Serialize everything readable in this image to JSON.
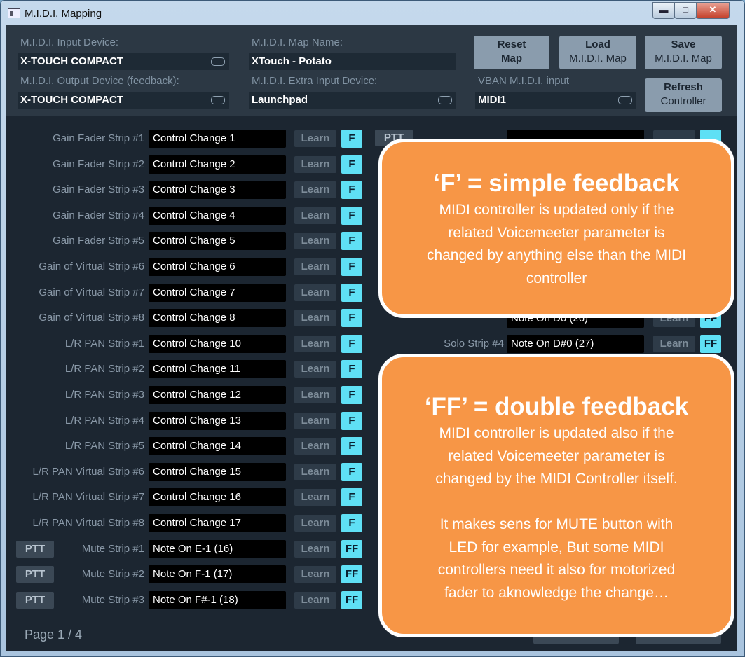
{
  "window": {
    "title": "M.I.D.I. Mapping",
    "min_glyph": "▬",
    "max_glyph": "□",
    "close_glyph": "✕"
  },
  "header": {
    "input_device_label": "M.I.D.I. Input Device:",
    "input_device_value": "X-TOUCH COMPACT",
    "map_name_label": "M.I.D.I. Map Name:",
    "map_name_value": "XTouch - Potato",
    "output_device_label": "M.I.D.I. Output Device (feedback):",
    "output_device_value": "X-TOUCH COMPACT",
    "extra_input_label": "M.I.D.I. Extra Input Device:",
    "extra_input_value": "Launchpad",
    "vban_label": "VBAN M.I.D.I. input",
    "vban_value": "MIDI1",
    "reset_line1": "Reset",
    "reset_line2": "Map",
    "load_line1": "Load",
    "load_line2": "M.I.D.I. Map",
    "save_line1": "Save",
    "save_line2": "M.I.D.I. Map",
    "refresh_line1": "Refresh",
    "refresh_line2": "Controller"
  },
  "learn_label": "Learn",
  "ptt_label": "PTT",
  "rows": [
    {
      "label": "Gain Fader Strip #1",
      "value": "Control Change 1",
      "fb": "F",
      "ptt": false
    },
    {
      "label": "Gain Fader Strip #2",
      "value": "Control Change 2",
      "fb": "F",
      "ptt": false
    },
    {
      "label": "Gain Fader Strip #3",
      "value": "Control Change 3",
      "fb": "F",
      "ptt": false
    },
    {
      "label": "Gain Fader Strip #4",
      "value": "Control Change 4",
      "fb": "F",
      "ptt": false
    },
    {
      "label": "Gain Fader Strip #5",
      "value": "Control Change 5",
      "fb": "F",
      "ptt": false
    },
    {
      "label": "Gain of Virtual Strip #6",
      "value": "Control Change 6",
      "fb": "F",
      "ptt": false
    },
    {
      "label": "Gain of Virtual Strip #7",
      "value": "Control Change 7",
      "fb": "F",
      "ptt": false
    },
    {
      "label": "Gain of Virtual Strip #8",
      "value": "Control Change 8",
      "fb": "F",
      "ptt": false
    },
    {
      "label": "L/R PAN Strip #1",
      "value": "Control Change 10",
      "fb": "F",
      "ptt": false
    },
    {
      "label": "L/R PAN Strip #2",
      "value": "Control Change 11",
      "fb": "F",
      "ptt": false
    },
    {
      "label": "L/R PAN Strip #3",
      "value": "Control Change 12",
      "fb": "F",
      "ptt": false
    },
    {
      "label": "L/R PAN Strip #4",
      "value": "Control Change 13",
      "fb": "F",
      "ptt": false
    },
    {
      "label": "L/R PAN Strip #5",
      "value": "Control Change 14",
      "fb": "F",
      "ptt": false
    },
    {
      "label": "L/R PAN Virtual Strip #6",
      "value": "Control Change 15",
      "fb": "F",
      "ptt": false
    },
    {
      "label": "L/R PAN Virtual Strip #7",
      "value": "Control Change 16",
      "fb": "F",
      "ptt": false
    },
    {
      "label": "L/R PAN Virtual Strip #8",
      "value": "Control Change 17",
      "fb": "F",
      "ptt": false
    },
    {
      "label": "Mute Strip #1",
      "value": "Note On E-1 (16)",
      "fb": "FF",
      "ptt": true
    },
    {
      "label": "Mute Strip #2",
      "value": "Note On F-1 (17)",
      "fb": "FF",
      "ptt": true
    },
    {
      "label": "Mute Strip #3",
      "value": "Note On F#-1 (18)",
      "fb": "FF",
      "ptt": true
    }
  ],
  "right_rows": {
    "solo3": {
      "value": "Note On D0 (26)",
      "fb": "FF"
    },
    "solo4": {
      "label": "Solo Strip #4",
      "value": "Note On D#0 (27)",
      "fb": "FF"
    }
  },
  "page_label": "Page 1 / 4",
  "callouts": {
    "f": {
      "title": "‘F’ = simple feedback",
      "body": "MIDI controller is updated only if the\nrelated Voicemeeter parameter is\nchanged by anything else than the MIDI\ncontroller"
    },
    "ff": {
      "title": "‘FF’ = double feedback",
      "body": "MIDI controller is updated also if the\nrelated Voicemeeter parameter is\nchanged by the MIDI Controller itself.\n\nIt makes  sens for MUTE button with\nLED for example, But some MIDI\ncontrollers need it also for motorized\nfader to aknowledge the change…"
    }
  }
}
